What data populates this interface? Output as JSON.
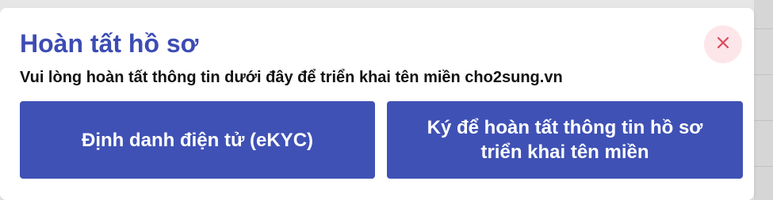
{
  "modal": {
    "title": "Hoàn tất hồ sơ",
    "subtitle": "Vui lòng hoàn tất thông tin dưới đây để triển khai tên miền cho2sung.vn",
    "close_icon": "close-icon",
    "buttons": {
      "ekyc_label": "Định danh điện tử (eKYC)",
      "sign_label": "Ký để hoàn tất thông tin hồ sơ\ntriển khai tên miền"
    }
  },
  "colors": {
    "title": "#3d4cb3",
    "button_bg": "#3f51b5",
    "close_bg": "#fde6ea",
    "close_icon": "#d84b5a"
  }
}
